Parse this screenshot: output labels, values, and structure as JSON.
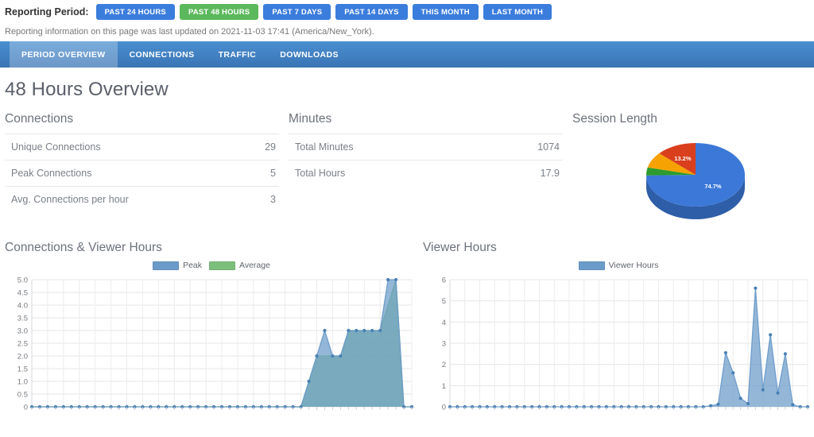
{
  "reporting": {
    "label": "Reporting Period:",
    "buttons": [
      {
        "label": "PAST 24 HOURS",
        "active": false
      },
      {
        "label": "PAST 48 HOURS",
        "active": true
      },
      {
        "label": "PAST 7 DAYS",
        "active": false
      },
      {
        "label": "PAST 14 DAYS",
        "active": false
      },
      {
        "label": "THIS MONTH",
        "active": false
      },
      {
        "label": "LAST MONTH",
        "active": false
      }
    ],
    "updated_note": "Reporting information on this page was last updated on 2021-11-03 17:41 (America/New_York).",
    "colors": {
      "primary": "#3b7ddd",
      "active": "#5cb85c"
    }
  },
  "tabs": [
    {
      "label": "PERIOD OVERVIEW",
      "active": true
    },
    {
      "label": "CONNECTIONS",
      "active": false
    },
    {
      "label": "TRAFFIC",
      "active": false
    },
    {
      "label": "DOWNLOADS",
      "active": false
    }
  ],
  "page_title": "48 Hours Overview",
  "connections_panel": {
    "title": "Connections",
    "rows": [
      {
        "label": "Unique Connections",
        "value": "29"
      },
      {
        "label": "Peak Connections",
        "value": "5"
      },
      {
        "label": "Avg. Connections per hour",
        "value": "3"
      }
    ]
  },
  "minutes_panel": {
    "title": "Minutes",
    "rows": [
      {
        "label": "Total Minutes",
        "value": "1074"
      },
      {
        "label": "Total Hours",
        "value": "17.9"
      }
    ]
  },
  "chart_data": [
    {
      "id": "session_length",
      "type": "pie",
      "title": "Session Length",
      "legend": "none",
      "three_d": true,
      "slices": [
        {
          "label": "74.7%",
          "value": 74.7,
          "color": "#3b78d8",
          "shown": true
        },
        {
          "label": "4.0%",
          "value": 4.0,
          "color": "#2e9b2e",
          "shown": false
        },
        {
          "label": "8.1%",
          "value": 8.1,
          "color": "#f5a202",
          "shown": false
        },
        {
          "label": "13.2%",
          "value": 13.2,
          "color": "#d93f1d",
          "shown": true
        }
      ]
    },
    {
      "id": "connections_viewer_hours",
      "type": "area",
      "title": "Connections & Viewer Hours",
      "xlabel": "",
      "ylabel": "",
      "ylim": [
        0,
        5
      ],
      "yticks": [
        "0",
        "0.5",
        "1.0",
        "1.5",
        "2.0",
        "2.5",
        "3.0",
        "3.5",
        "4.0",
        "4.5",
        "5.0"
      ],
      "grid": true,
      "legend_position": "top-center",
      "x_tick_labels_rotated": true,
      "series": [
        {
          "name": "Peak",
          "color": "#6b9bc9",
          "values": [
            0,
            0,
            0,
            0,
            0,
            0,
            0,
            0,
            0,
            0,
            0,
            0,
            0,
            0,
            0,
            0,
            0,
            0,
            0,
            0,
            0,
            0,
            0,
            0,
            0,
            0,
            0,
            0,
            0,
            0,
            0,
            0,
            0,
            0,
            0,
            1,
            2,
            3,
            2,
            2,
            3,
            3,
            3,
            3,
            3,
            5,
            5,
            0,
            0
          ]
        },
        {
          "name": "Average",
          "color": "#7cbf7c",
          "values": [
            0,
            0,
            0,
            0,
            0,
            0,
            0,
            0,
            0,
            0,
            0,
            0,
            0,
            0,
            0,
            0,
            0,
            0,
            0,
            0,
            0,
            0,
            0,
            0,
            0,
            0,
            0,
            0,
            0,
            0,
            0,
            0,
            0,
            0,
            0,
            1,
            2,
            2,
            2,
            2,
            3,
            3,
            3,
            3,
            3,
            4,
            5,
            0,
            0
          ]
        }
      ]
    },
    {
      "id": "viewer_hours",
      "type": "area",
      "title": "Viewer Hours",
      "xlabel": "",
      "ylabel": "",
      "ylim": [
        0,
        6
      ],
      "yticks": [
        "0",
        "1",
        "2",
        "3",
        "4",
        "5",
        "6"
      ],
      "grid": true,
      "legend_position": "top-center",
      "x_tick_labels_rotated": true,
      "series": [
        {
          "name": "Viewer Hours",
          "color": "#6b9bc9",
          "values": [
            0,
            0,
            0,
            0,
            0,
            0,
            0,
            0,
            0,
            0,
            0,
            0,
            0,
            0,
            0,
            0,
            0,
            0,
            0,
            0,
            0,
            0,
            0,
            0,
            0,
            0,
            0,
            0,
            0,
            0,
            0,
            0,
            0,
            0,
            0,
            0.05,
            0.12,
            2.55,
            1.6,
            0.4,
            0.15,
            5.6,
            0.8,
            3.4,
            0.65,
            2.5,
            0.1,
            0,
            0
          ]
        }
      ]
    }
  ]
}
